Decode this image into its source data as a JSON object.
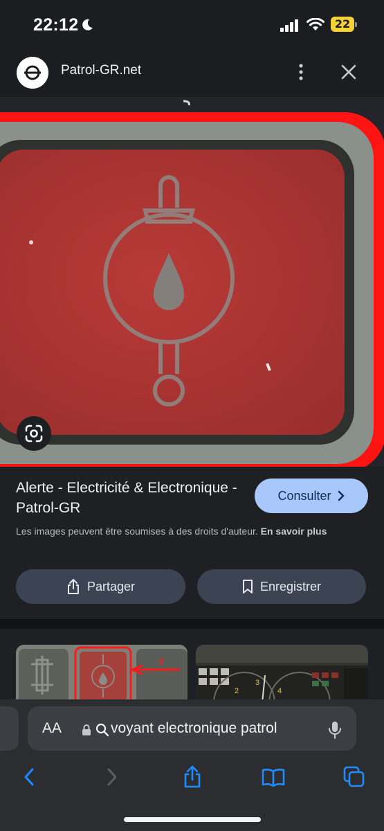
{
  "status_bar": {
    "time": "22:12",
    "battery": "22"
  },
  "header": {
    "site_name": "Patrol-GR.net"
  },
  "result": {
    "title": "Alerte - Electricité & Electronique - Patrol-GR",
    "consult_label": "Consulter",
    "copyright_text": "Les images peuvent être soumises à des droits d'auteur.",
    "learn_more": "En savoir plus",
    "share_label": "Partager",
    "save_label": "Enregistrer"
  },
  "related_thumb_1": {
    "annotation": "7"
  },
  "related_thumb_2": {
    "gauge_labels": [
      "2",
      "3",
      "4"
    ]
  },
  "address_bar": {
    "aa_label": "AA",
    "query": "voyant electronique patrol"
  },
  "colors": {
    "accent_button": "#a8c7fa",
    "pill_button": "#3c4454",
    "highlight_red": "#ff1a1a",
    "ios_blue": "#1e8cff"
  }
}
